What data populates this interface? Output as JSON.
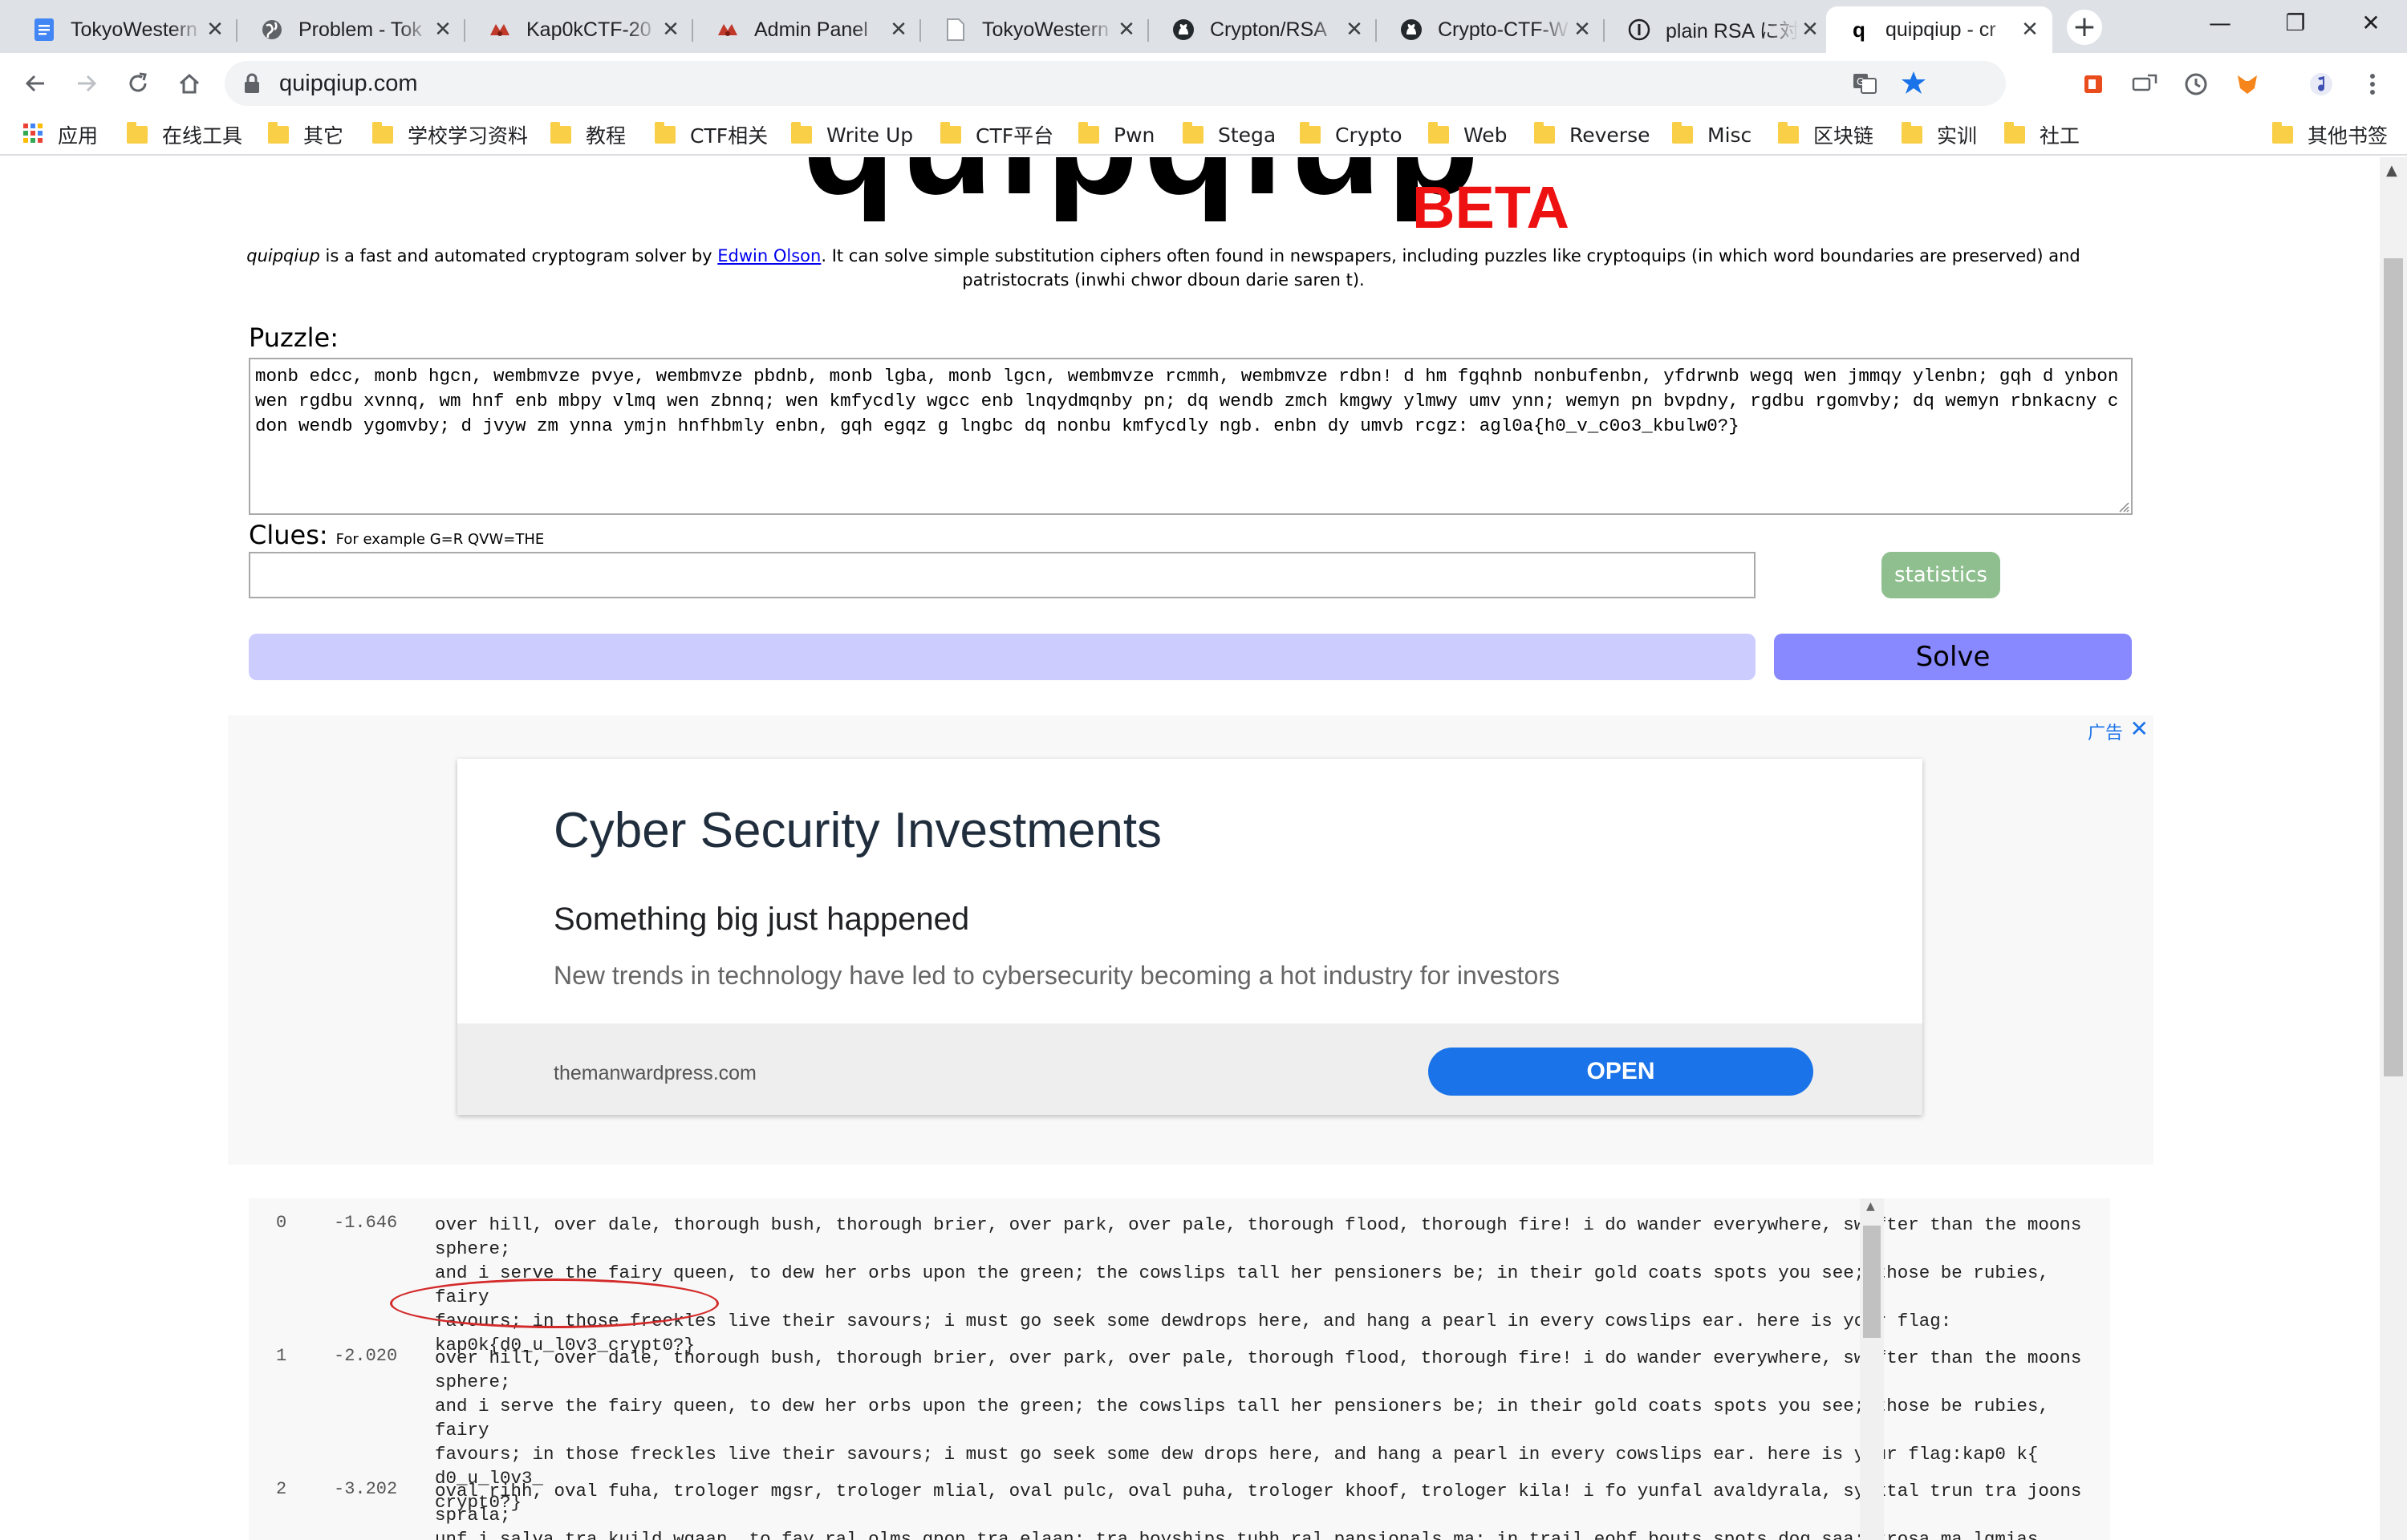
{
  "browser": {
    "tabs": [
      {
        "title": "TokyoWestern",
        "icon": "google-docs-icon",
        "active": false
      },
      {
        "title": "Problem - Tok",
        "icon": "globe-icon",
        "active": false
      },
      {
        "title": "Kap0kCTF-20",
        "icon": "ctf-icon",
        "active": false
      },
      {
        "title": "Admin Panel",
        "icon": "ctf-icon",
        "active": false
      },
      {
        "title": "TokyoWestern",
        "icon": "page-icon",
        "active": false
      },
      {
        "title": "Crypton/RSA",
        "icon": "github-icon",
        "active": false
      },
      {
        "title": "Crypto-CTF-W",
        "icon": "github-icon",
        "active": false
      },
      {
        "title": "plain RSA に対",
        "icon": "info-icon",
        "active": false
      },
      {
        "title": "quipqiup - cr",
        "icon": "quipqiup-icon",
        "active": true
      }
    ],
    "new_tab_label": "+",
    "window_controls": {
      "minimize": "—",
      "restore": "❐",
      "close": "✕"
    },
    "url": "quipqiup.com",
    "bookmarks": [
      {
        "label": "应用",
        "icon": "apps-grid-icon"
      },
      {
        "label": "在线工具"
      },
      {
        "label": "其它"
      },
      {
        "label": "学校学习资料"
      },
      {
        "label": "教程"
      },
      {
        "label": "CTF相关"
      },
      {
        "label": "Write Up"
      },
      {
        "label": "CTF平台"
      },
      {
        "label": "Pwn"
      },
      {
        "label": "Stega"
      },
      {
        "label": "Crypto"
      },
      {
        "label": "Web"
      },
      {
        "label": "Reverse"
      },
      {
        "label": "Misc"
      },
      {
        "label": "区块链"
      },
      {
        "label": "实训"
      },
      {
        "label": "社工"
      }
    ],
    "other_bookmarks": "其他书签"
  },
  "page": {
    "logo": {
      "text": "quipqiup",
      "beta": "BETA"
    },
    "intro": {
      "site_name": "quipqiup",
      "before_author": " is a fast and automated cryptogram solver by ",
      "author": "Edwin Olson",
      "after_author": ". It can solve simple substitution ciphers often found in newspapers, including puzzles like cryptoquips (in which word boundaries are preserved) and patristocrats (inwhi chwor dboun darie saren t)."
    },
    "puzzle": {
      "label": "Puzzle:",
      "value": "monb edcc, monb hgcn, wembmvze pvye, wembmvze pbdnb, monb lgba, monb lgcn, wembmvze rcmmh, wembmvze rdbn! d hm fgqhnb nonbufenbn, yfdrwnb wegq wen jmmqy ylenbn; gqh d ynbon wen rgdbu xvnnq, wm hnf enb mbpy vlmq wen zbnnq; wen kmfycdly wgcc enb lnqydmqnby pn; dq wendb zmch kmgwy ylmwy umv ynn; wemyn pn bvpdny, rgdbu rgomvby; dq wemyn rbnkacny cdon wendb ygomvby; d jvyw zm ynna ymjn hnfhbmly enbn, gqh egqz g lngbc dq nonbu kmfycdly ngb. enbn dy umvb rcgz: agl0a{h0_v_c0o3_kbulw0?}"
    },
    "clues": {
      "label": "Clues:",
      "example": "For example G=R QVW=THE",
      "value": ""
    },
    "statistics_label": "statistics",
    "solve_label": "Solve",
    "ad": {
      "label": "广告",
      "close": "✕",
      "title": "Cyber Security Investments",
      "subtitle": "Something big just happened",
      "body": "New trends in technology have led to cybersecurity becoming a hot industry for investors",
      "domain": "themanwardpress.com",
      "cta": "OPEN"
    },
    "results": [
      {
        "index": "0",
        "score": "-1.646",
        "text": "over hill, over dale, thorough bush, thorough brier, over park, over pale, thorough flood, thorough fire! i do wander everywhere, swifter than the moons sphere;\nand i serve the fairy queen, to dew her orbs upon the green; the cowslips tall her pensioners be; in their gold coats spots you see; those be rubies, fairy\nfavours; in those freckles live their savours; i must go seek some dewdrops here, and hang a pearl in every cowslips ear. here is your flag:\nkap0k{d0_u_l0v3_crypt0?}"
      },
      {
        "index": "1",
        "score": "-2.020",
        "text": "over hill, over dale, thorough bush, thorough brier, over park, over pale, thorough flood, thorough fire! i do wander everywhere, swifter than the moons sphere;\nand i serve the fairy queen, to dew her orbs upon the green; the cowslips tall her pensioners be; in their gold coats spots you see; those be rubies, fairy\nfavours; in those freckles live their savours; i must go seek some dew drops here, and hang a pearl in every cowslips ear. here is your flag:kap0 k{ d0_u_l0v3_\ncrypt0?}"
      },
      {
        "index": "2",
        "score": "-3.202",
        "text": "oval rihh, oval fuha, trologer mgsr, trologer mlial, oval pulc, oval puha, trologer khoof, trologer kila! i fo yunfal avaldyrala, syiktal trun tra joons sprala;\nunf i salva tra kuild wgaan, to fay ral olms gpon tra elaan; tra boyships tuhh ral pansionals ma; in trail eohf bouts spots dog saa; trosa ma lgmias, kuild\nkuvogls; in trosa klabchas hiva trail suvogls; i jgst eo saac soja fayflops rala, unf rune u paulh in avald boyships aul. rala is dogl khue:"
      }
    ]
  }
}
